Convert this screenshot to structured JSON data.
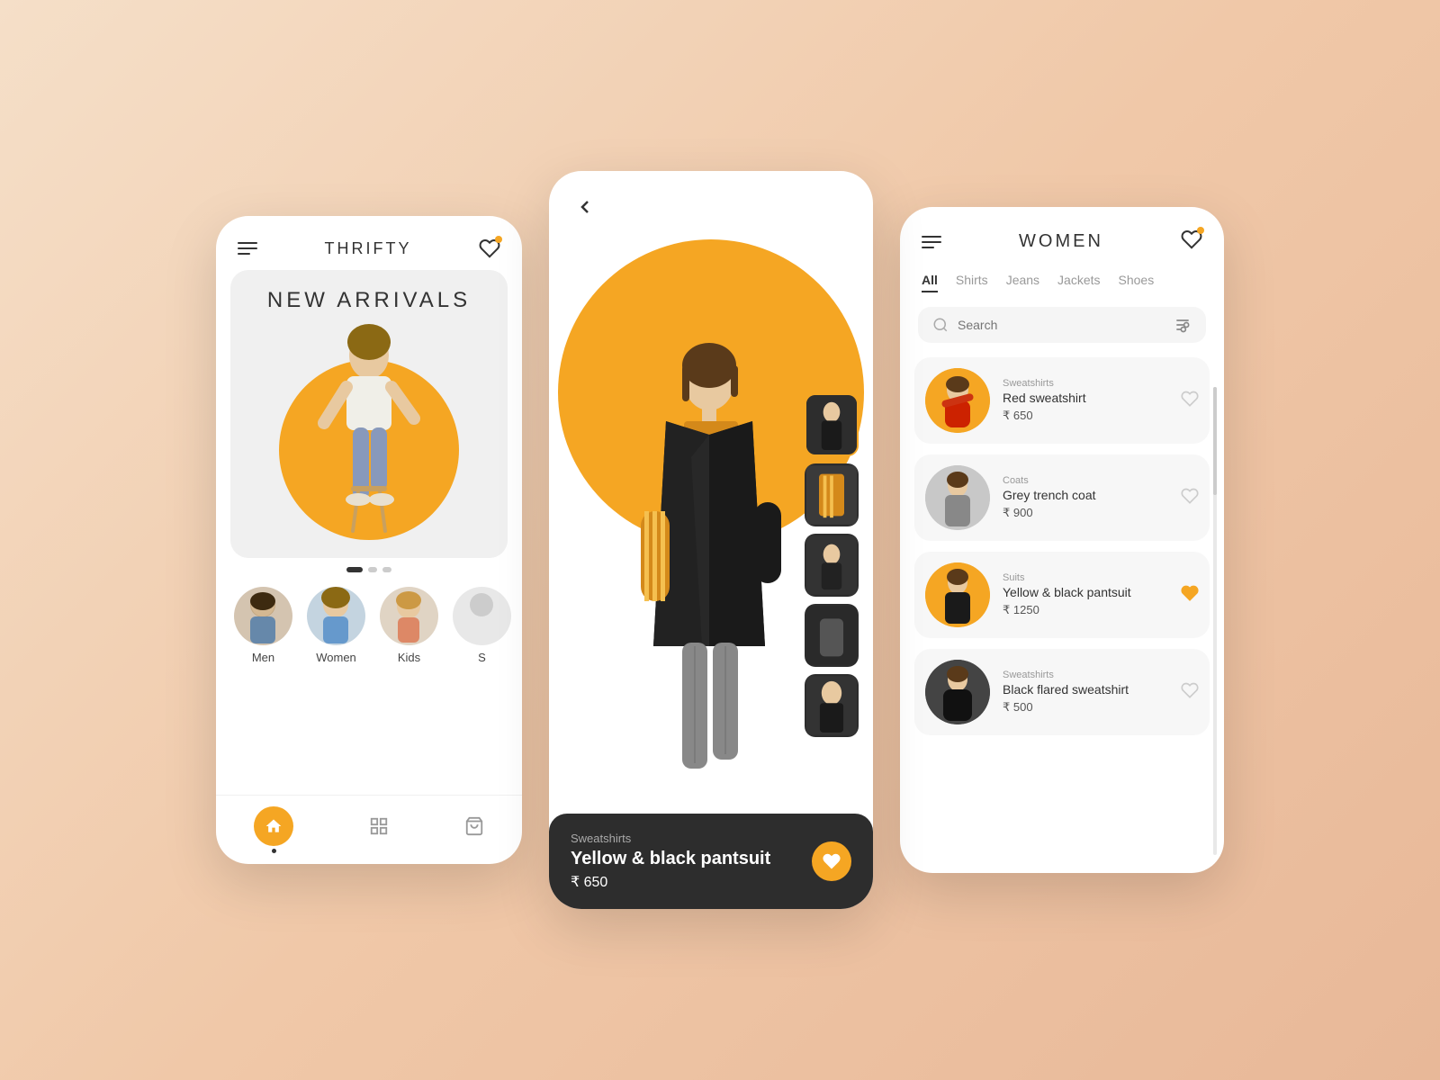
{
  "app": {
    "title": "THRIFTY",
    "background_color": "#f5dfc8"
  },
  "screen_home": {
    "header": {
      "menu_icon": "hamburger",
      "title": "THRIFTY",
      "heart_icon": "heart",
      "notification": true
    },
    "hero": {
      "title": "NEW ARRIVALS",
      "image_alt": "woman sitting on stool",
      "dots": [
        {
          "active": true
        },
        {
          "active": false
        },
        {
          "active": false
        }
      ]
    },
    "categories": [
      {
        "label": "Men",
        "type": "man"
      },
      {
        "label": "Women",
        "type": "woman"
      },
      {
        "label": "Kids",
        "type": "kids"
      },
      {
        "label": "S",
        "type": "more"
      }
    ],
    "bottom_nav": [
      {
        "icon": "home",
        "active": true,
        "label": "home"
      },
      {
        "icon": "grid",
        "active": false,
        "label": "grid"
      },
      {
        "icon": "bag",
        "active": false,
        "label": "bag"
      }
    ]
  },
  "screen_detail": {
    "back_label": "‹",
    "product": {
      "category": "Sweatshirts",
      "name": "Yellow & black pantsuit",
      "price": "₹ 650",
      "price_value": "650",
      "currency": "₹",
      "liked": true
    },
    "thumbnails": [
      {
        "alt": "view 1",
        "active": true
      },
      {
        "alt": "view 2",
        "active": false
      },
      {
        "alt": "view 3",
        "active": false
      },
      {
        "alt": "view 4",
        "active": false
      },
      {
        "alt": "view 5",
        "active": false
      }
    ]
  },
  "screen_list": {
    "header": {
      "menu_icon": "hamburger",
      "title": "WOMEN",
      "heart_icon": "heart"
    },
    "filter_tabs": [
      {
        "label": "All",
        "active": true
      },
      {
        "label": "Shirts",
        "active": false
      },
      {
        "label": "Jeans",
        "active": false
      },
      {
        "label": "Jackets",
        "active": false
      },
      {
        "label": "Shoes",
        "active": false
      }
    ],
    "search": {
      "placeholder": "Search",
      "icon": "search"
    },
    "products": [
      {
        "category": "Sweatshirts",
        "name": "Red sweatshirt",
        "price": "₹ 650",
        "price_value": "650",
        "currency": "₹",
        "liked": false,
        "bg": "orange"
      },
      {
        "category": "Coats",
        "name": "Grey trench coat",
        "price": "₹ 900",
        "price_value": "900",
        "currency": "₹",
        "liked": false,
        "bg": "gray"
      },
      {
        "category": "Suits",
        "name": "Yellow & black pantsuit",
        "price": "₹ 1250",
        "price_value": "1250",
        "currency": "₹",
        "liked": true,
        "bg": "orange"
      },
      {
        "category": "Sweatshirts",
        "name": "Black flared sweatshirt",
        "price": "₹ 500",
        "price_value": "500",
        "currency": "₹",
        "liked": false,
        "bg": "dark"
      }
    ]
  }
}
